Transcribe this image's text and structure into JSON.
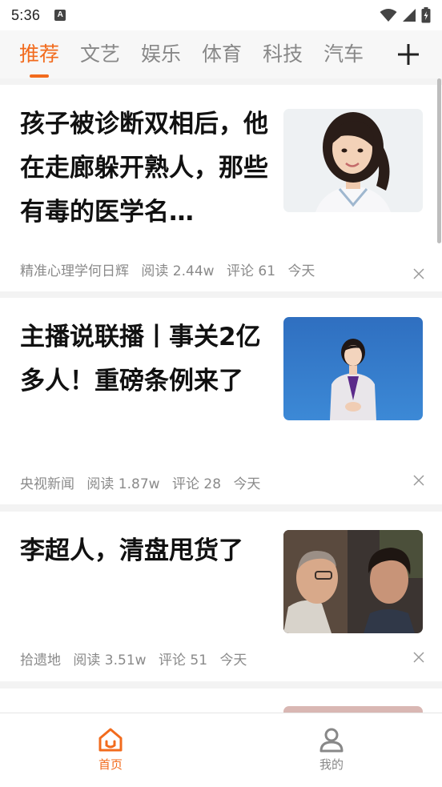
{
  "status_bar": {
    "time": "5:36",
    "notification_icon": "a-badge-icon",
    "wifi_icon": "wifi-icon",
    "signal_icon": "signal-icon",
    "battery_icon": "battery-charging-icon"
  },
  "tabs": [
    {
      "label": "推荐",
      "active": true
    },
    {
      "label": "文艺",
      "active": false
    },
    {
      "label": "娱乐",
      "active": false
    },
    {
      "label": "体育",
      "active": false
    },
    {
      "label": "科技",
      "active": false
    },
    {
      "label": "汽车",
      "active": false
    }
  ],
  "tab_add_icon": "plus-icon",
  "feed": {
    "articles": [
      {
        "title": "孩子被诊断双相后，他在走廊躲开熟人，那些有毒的医学名…",
        "source": "精准心理学何日辉",
        "reads": "阅读 2.44w",
        "comments": "评论 61",
        "time": "今天",
        "thumbnail": "portrait-of-smiling-doctor"
      },
      {
        "title": "主播说联播丨事关2亿多人！重磅条例来了",
        "source": "央视新闻",
        "reads": "阅读 1.87w",
        "comments": "评论 28",
        "time": "今天",
        "thumbnail": "news-anchor-in-studio"
      },
      {
        "title": "李超人，清盘甩货了",
        "source": "拾遗地",
        "reads": "阅读 3.51w",
        "comments": "评论 51",
        "time": "今天",
        "thumbnail": "film-still-two-men"
      }
    ],
    "close_icon": "close-icon"
  },
  "bottom_nav": [
    {
      "label": "首页",
      "icon": "home-icon",
      "active": true
    },
    {
      "label": "我的",
      "icon": "profile-icon",
      "active": false
    }
  ],
  "colors": {
    "accent": "#f26b1d",
    "title_text": "#111111",
    "meta_text": "#8a8a8a",
    "inactive_tab": "#888888"
  }
}
